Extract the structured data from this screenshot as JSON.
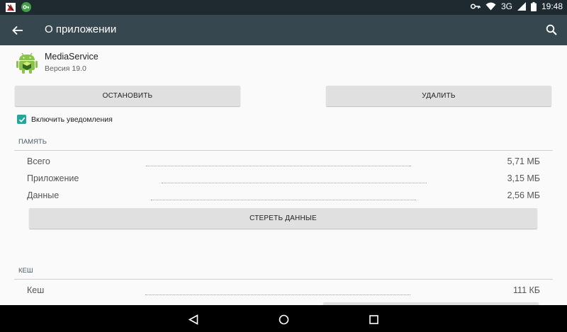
{
  "status_bar": {
    "time": "19:48",
    "network": "3G",
    "icons": [
      "notification-app-icon",
      "vpn-key-icon",
      "key-icon",
      "wifi-icon",
      "cellular-signal-icon",
      "battery-icon"
    ]
  },
  "toolbar": {
    "title": "О приложении",
    "back_icon": "arrow-left-icon",
    "search_icon": "search-icon"
  },
  "app": {
    "name": "MediaService",
    "version": "Версия 19.0",
    "icon": "android-icon"
  },
  "actions": {
    "stop_label": "ОСТАНОВИТЬ",
    "delete_label": "УДАЛИТЬ"
  },
  "notifications": {
    "label": "Включить уведомления",
    "checked": true
  },
  "memory": {
    "header": "ПАМЯТЬ",
    "rows": [
      {
        "label": "Всего",
        "value": "5,71 МБ"
      },
      {
        "label": "Приложение",
        "value": "3,15 МБ"
      },
      {
        "label": "Данные",
        "value": "2,56 МБ"
      }
    ],
    "clear_label": "СТЕРЕТЬ ДАННЫЕ"
  },
  "cache": {
    "header": "КЕШ",
    "rows": [
      {
        "label": "Кеш",
        "value": "111 КБ"
      }
    ]
  },
  "colors": {
    "status_bar": "#1f2a30",
    "toolbar": "#37474f",
    "accent": "#26a69a",
    "button": "#e0e0e0",
    "background": "#fafafa",
    "nav_bar": "#000000"
  }
}
